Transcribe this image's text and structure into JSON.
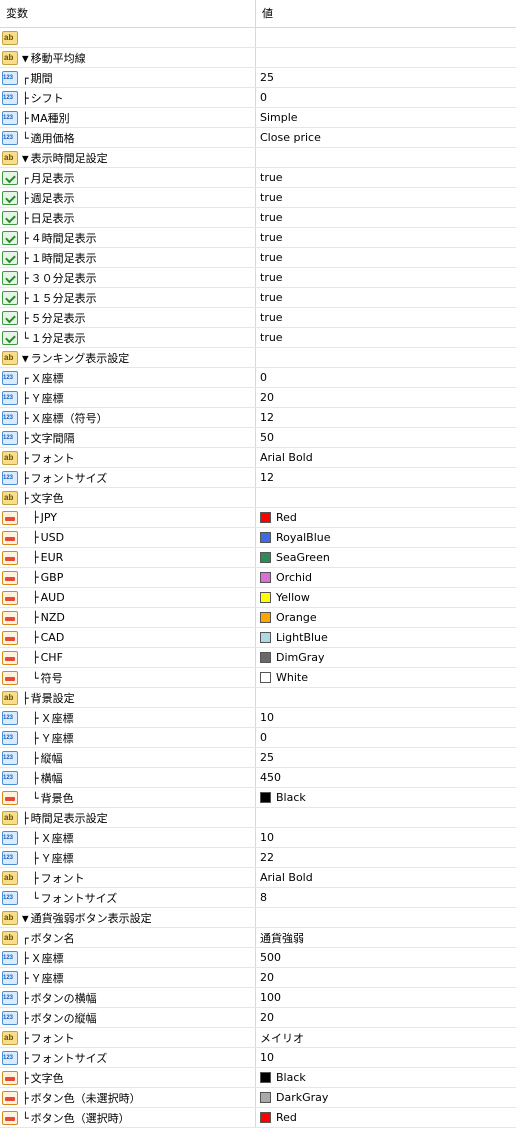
{
  "header": {
    "col_name": "変数",
    "col_value": "値"
  },
  "rows": [
    {
      "icon": "ab",
      "prefix": "",
      "label": "",
      "value": "",
      "swatch": null
    },
    {
      "icon": "ab",
      "prefix": "▼",
      "label": "移動平均線",
      "value": "",
      "swatch": null
    },
    {
      "icon": "num",
      "prefix": "┌",
      "label": "期間",
      "value": "25",
      "swatch": null
    },
    {
      "icon": "num",
      "prefix": "├",
      "label": "シフト",
      "value": "0",
      "swatch": null
    },
    {
      "icon": "num",
      "prefix": "├",
      "label": "MA種別",
      "value": "Simple",
      "swatch": null
    },
    {
      "icon": "num",
      "prefix": "└",
      "label": "適用価格",
      "value": "Close price",
      "swatch": null
    },
    {
      "icon": "ab",
      "prefix": "▼",
      "label": "表示時間足設定",
      "value": "",
      "swatch": null
    },
    {
      "icon": "bool",
      "prefix": "┌",
      "label": "月足表示",
      "value": "true",
      "swatch": null
    },
    {
      "icon": "bool",
      "prefix": "├",
      "label": "週足表示",
      "value": "true",
      "swatch": null
    },
    {
      "icon": "bool",
      "prefix": "├",
      "label": "日足表示",
      "value": "true",
      "swatch": null
    },
    {
      "icon": "bool",
      "prefix": "├",
      "label": "４時間足表示",
      "value": "true",
      "swatch": null
    },
    {
      "icon": "bool",
      "prefix": "├",
      "label": "１時間足表示",
      "value": "true",
      "swatch": null
    },
    {
      "icon": "bool",
      "prefix": "├",
      "label": "３０分足表示",
      "value": "true",
      "swatch": null
    },
    {
      "icon": "bool",
      "prefix": "├",
      "label": "１５分足表示",
      "value": "true",
      "swatch": null
    },
    {
      "icon": "bool",
      "prefix": "├",
      "label": "５分足表示",
      "value": "true",
      "swatch": null
    },
    {
      "icon": "bool",
      "prefix": "└",
      "label": "１分足表示",
      "value": "true",
      "swatch": null
    },
    {
      "icon": "ab",
      "prefix": "▼",
      "label": "ランキング表示設定",
      "value": "",
      "swatch": null
    },
    {
      "icon": "num",
      "prefix": "┌",
      "label": "Ｘ座標",
      "value": "0",
      "swatch": null
    },
    {
      "icon": "num",
      "prefix": "├",
      "label": "Ｙ座標",
      "value": "20",
      "swatch": null
    },
    {
      "icon": "num",
      "prefix": "├",
      "label": "Ｘ座標（符号）",
      "value": "12",
      "swatch": null
    },
    {
      "icon": "num",
      "prefix": "├",
      "label": "文字間隔",
      "value": "50",
      "swatch": null
    },
    {
      "icon": "ab",
      "prefix": "├",
      "label": "フォント",
      "value": "Arial Bold",
      "swatch": null
    },
    {
      "icon": "num",
      "prefix": "├",
      "label": "フォントサイズ",
      "value": "12",
      "swatch": null
    },
    {
      "icon": "ab",
      "prefix": "├",
      "label": "文字色",
      "value": "",
      "swatch": null
    },
    {
      "icon": "color",
      "prefix": "├",
      "label": "JPY",
      "value": "Red",
      "swatch": "#ff0000",
      "indent": true
    },
    {
      "icon": "color",
      "prefix": "├",
      "label": "USD",
      "value": "RoyalBlue",
      "swatch": "#4169e1",
      "indent": true
    },
    {
      "icon": "color",
      "prefix": "├",
      "label": "EUR",
      "value": "SeaGreen",
      "swatch": "#2e8b57",
      "indent": true
    },
    {
      "icon": "color",
      "prefix": "├",
      "label": "GBP",
      "value": "Orchid",
      "swatch": "#da70d6",
      "indent": true
    },
    {
      "icon": "color",
      "prefix": "├",
      "label": "AUD",
      "value": "Yellow",
      "swatch": "#ffff00",
      "indent": true
    },
    {
      "icon": "color",
      "prefix": "├",
      "label": "NZD",
      "value": "Orange",
      "swatch": "#ffa500",
      "indent": true
    },
    {
      "icon": "color",
      "prefix": "├",
      "label": "CAD",
      "value": "LightBlue",
      "swatch": "#add8e6",
      "indent": true
    },
    {
      "icon": "color",
      "prefix": "├",
      "label": "CHF",
      "value": "DimGray",
      "swatch": "#696969",
      "indent": true
    },
    {
      "icon": "color",
      "prefix": "└",
      "label": "符号",
      "value": "White",
      "swatch": "#ffffff",
      "indent": true
    },
    {
      "icon": "ab",
      "prefix": "├",
      "label": "背景設定",
      "value": "",
      "swatch": null
    },
    {
      "icon": "num",
      "prefix": "├",
      "label": "Ｘ座標",
      "value": "10",
      "swatch": null,
      "indent": true
    },
    {
      "icon": "num",
      "prefix": "├",
      "label": "Ｙ座標",
      "value": "0",
      "swatch": null,
      "indent": true
    },
    {
      "icon": "num",
      "prefix": "├",
      "label": "縦幅",
      "value": "25",
      "swatch": null,
      "indent": true
    },
    {
      "icon": "num",
      "prefix": "├",
      "label": "横幅",
      "value": "450",
      "swatch": null,
      "indent": true
    },
    {
      "icon": "color",
      "prefix": "└",
      "label": "背景色",
      "value": "Black",
      "swatch": "#000000",
      "indent": true
    },
    {
      "icon": "ab",
      "prefix": "├",
      "label": "時間足表示設定",
      "value": "",
      "swatch": null
    },
    {
      "icon": "num",
      "prefix": "├",
      "label": "Ｘ座標",
      "value": "10",
      "swatch": null,
      "indent": true
    },
    {
      "icon": "num",
      "prefix": "├",
      "label": "Ｙ座標",
      "value": "22",
      "swatch": null,
      "indent": true
    },
    {
      "icon": "ab",
      "prefix": "├",
      "label": "フォント",
      "value": "Arial Bold",
      "swatch": null,
      "indent": true
    },
    {
      "icon": "num",
      "prefix": "└",
      "label": "フォントサイズ",
      "value": "8",
      "swatch": null,
      "indent": true
    },
    {
      "icon": "ab",
      "prefix": "▼",
      "label": "通貨強弱ボタン表示設定",
      "value": "",
      "swatch": null
    },
    {
      "icon": "ab",
      "prefix": "┌",
      "label": "ボタン名",
      "value": "通貨強弱",
      "swatch": null
    },
    {
      "icon": "num",
      "prefix": "├",
      "label": "Ｘ座標",
      "value": "500",
      "swatch": null
    },
    {
      "icon": "num",
      "prefix": "├",
      "label": "Ｙ座標",
      "value": "20",
      "swatch": null
    },
    {
      "icon": "num",
      "prefix": "├",
      "label": "ボタンの横幅",
      "value": "100",
      "swatch": null
    },
    {
      "icon": "num",
      "prefix": "├",
      "label": "ボタンの縦幅",
      "value": "20",
      "swatch": null
    },
    {
      "icon": "ab",
      "prefix": "├",
      "label": "フォント",
      "value": "メイリオ",
      "swatch": null
    },
    {
      "icon": "num",
      "prefix": "├",
      "label": "フォントサイズ",
      "value": "10",
      "swatch": null
    },
    {
      "icon": "color",
      "prefix": "├",
      "label": "文字色",
      "value": "Black",
      "swatch": "#000000"
    },
    {
      "icon": "color",
      "prefix": "├",
      "label": "ボタン色（未選択時）",
      "value": "DarkGray",
      "swatch": "#a9a9a9"
    },
    {
      "icon": "color",
      "prefix": "└",
      "label": "ボタン色（選択時）",
      "value": "Red",
      "swatch": "#ff0000"
    }
  ]
}
